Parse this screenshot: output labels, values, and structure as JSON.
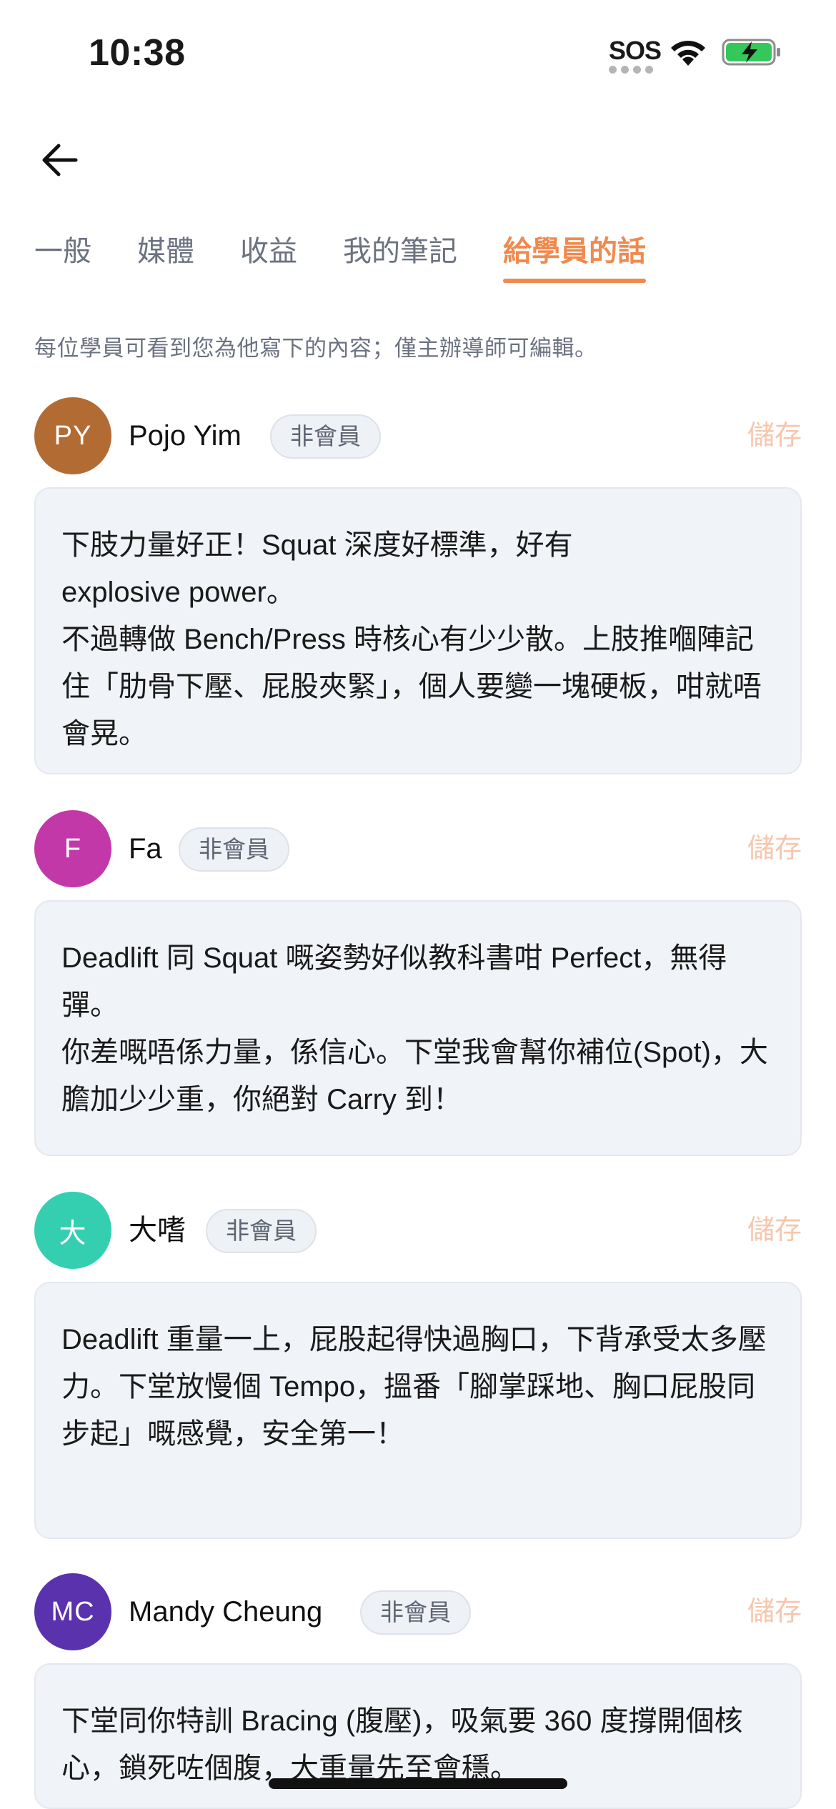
{
  "status_bar": {
    "time": "10:38",
    "sos": "SOS"
  },
  "tabs": [
    {
      "label": "一般",
      "active": false
    },
    {
      "label": "媒體",
      "active": false
    },
    {
      "label": "收益",
      "active": false
    },
    {
      "label": "我的筆記",
      "active": false
    },
    {
      "label": "給學員的話",
      "active": true
    }
  ],
  "hint": "每位學員可看到您為他寫下的內容；僅主辦導師可編輯。",
  "students": [
    {
      "initials": "PY",
      "avatar_color": "#b36b34",
      "name": "Pojo Yim",
      "badge": "非會員",
      "save_label": "儲存",
      "note": "下肢力量好正！Squat 深度好標準，好有\nexplosive power。\n不過轉做 Bench/Press 時核心有少少散。上肢推嗰陣記住「肋骨下壓、屁股夾緊」，個人要變一塊硬板，咁就唔會晃。"
    },
    {
      "initials": "F",
      "avatar_color": "#c238a8",
      "name": "Fa",
      "badge": "非會員",
      "save_label": "儲存",
      "note": "Deadlift 同 Squat 嘅姿勢好似教科書咁 Perfect，無得彈。\n你差嘅唔係力量，係信心。下堂我會幫你補位(Spot)，大膽加少少重，你絕對 Carry 到！"
    },
    {
      "initials": "大",
      "avatar_color": "#34cfb0",
      "name": "大嗜",
      "badge": "非會員",
      "save_label": "儲存",
      "note": "Deadlift 重量一上，屁股起得快過胸口，下背承受太多壓力。下堂放慢個 Tempo，搵番「腳掌踩地、胸口屁股同步起」嘅感覺，安全第一！"
    },
    {
      "initials": "MC",
      "avatar_color": "#5a32ad",
      "name": "Mandy Cheung",
      "badge": "非會員",
      "save_label": "儲存",
      "note": "下堂同你特訓 Bracing (腹壓)，吸氣要 360 度撐開個核心，鎖死咗個腹，大重量先至會穩。"
    }
  ],
  "colors": {
    "accent": "#ef8a4e",
    "save_disabled": "#f6c6ac",
    "card_bg": "#f0f3f8"
  }
}
